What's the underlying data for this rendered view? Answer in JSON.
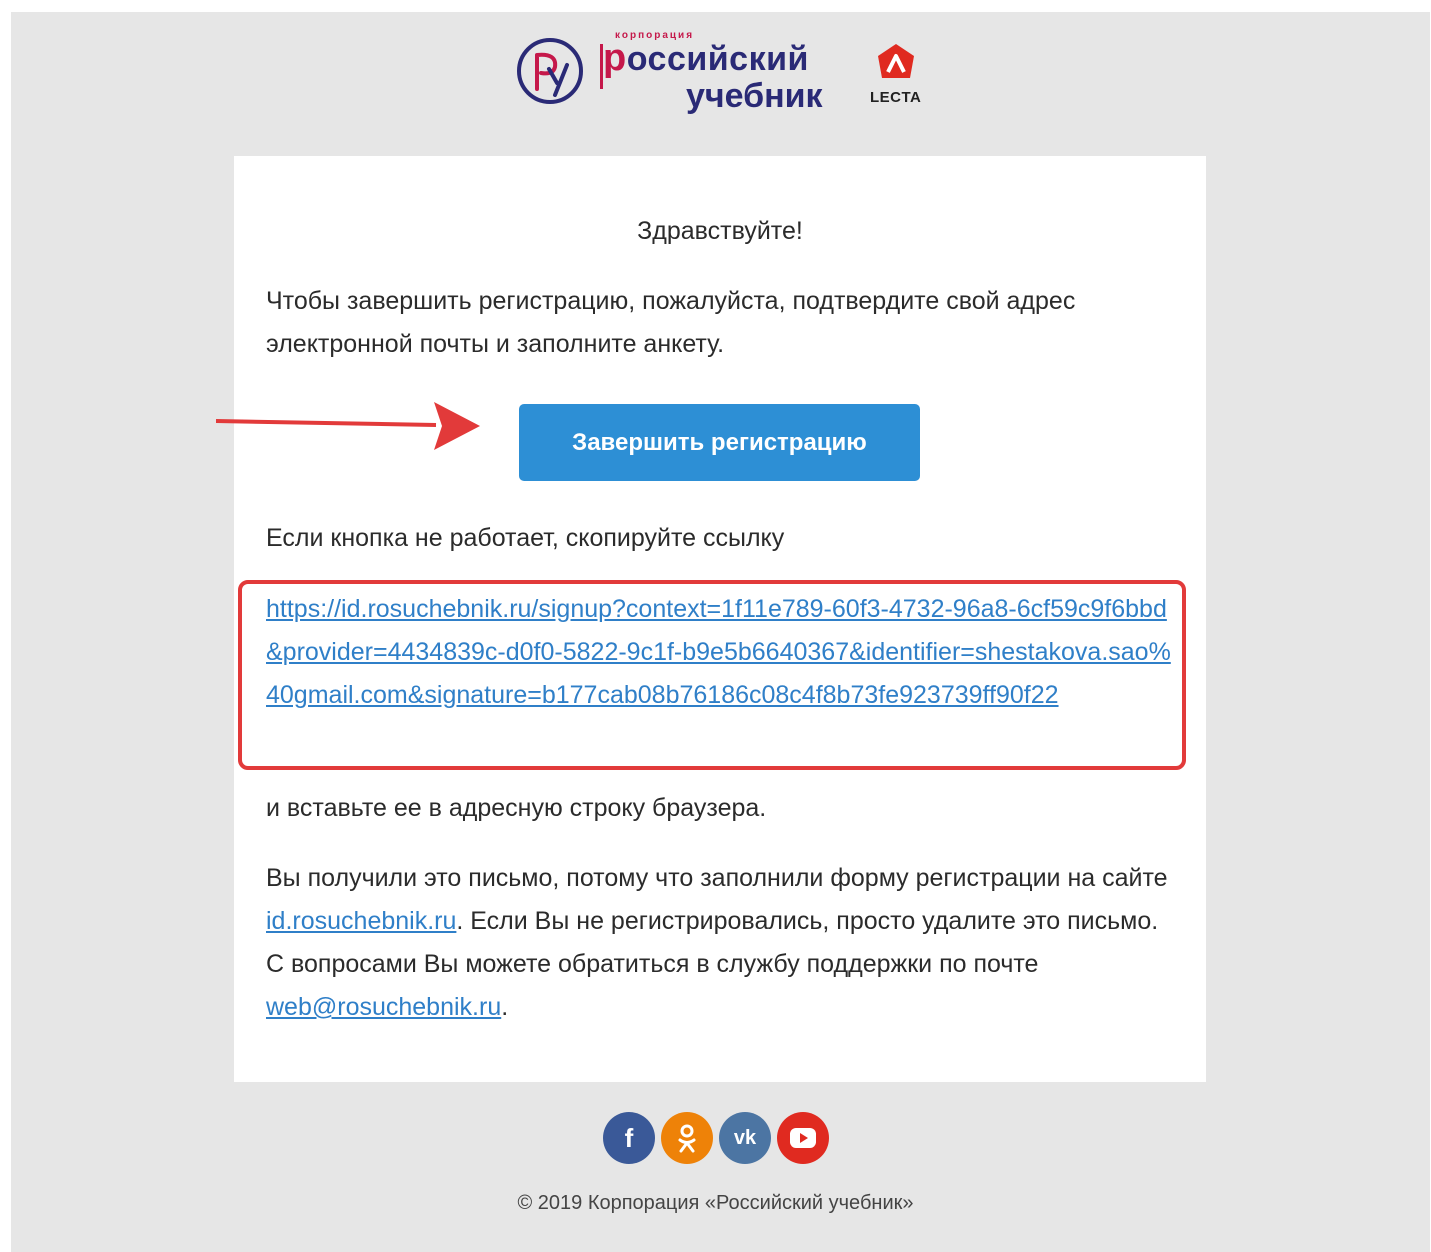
{
  "header": {
    "logo_small": "корпорация",
    "logo_line1_first": "р",
    "logo_line1_rest": "оссийский",
    "logo_line2": "учебник",
    "lecta": "LECTA",
    "colors": {
      "navy": "#2a2a76",
      "crimson": "#c5184a"
    }
  },
  "email": {
    "greeting": "Здравствуйте!",
    "paragraph1": "Чтобы завершить регистрацию, пожалуйста, подтвердите свой адрес электронной почты и заполните анкету.",
    "button_label": "Завершить регистрацию",
    "paragraph2": "Если кнопка не работает, скопируйте ссылку",
    "link_url": "https://id.rosuchebnik.ru/signup?context=1f11e789-60f3-4732-96a8-6cf59c9f6bbd&provider=4434839c-d0f0-5822-9c1f-b9e5b6640367&identifier=shestakova.sao%40gmail.com&signature=b177cab08b76186c08c4f8b73fe923739ff90f22",
    "paragraph3": "и вставьте ее в адресную строку браузера.",
    "p4_part1": "Вы получили это письмо, потому что заполнили форму регистрации на сайте ",
    "p4_link1": "id.rosuchebnik.ru",
    "p4_part2": ". Если Вы не регистрировались, просто удалите это письмо. С вопросами Вы можете обратиться в службу поддержки по почте ",
    "p4_link2": "web@rosuchebnik.ru",
    "p4_part3": "."
  },
  "social": {
    "facebook": "f",
    "odnoklassniki": "ok",
    "vk": "vk",
    "youtube": "▶"
  },
  "footer": {
    "copyright": "© 2019 Корпорация «Российский учебник»"
  },
  "colors": {
    "button": "#2d8fd5",
    "link": "#2f7fc8",
    "highlight": "#e23a3a",
    "background": "#e6e6e6"
  }
}
